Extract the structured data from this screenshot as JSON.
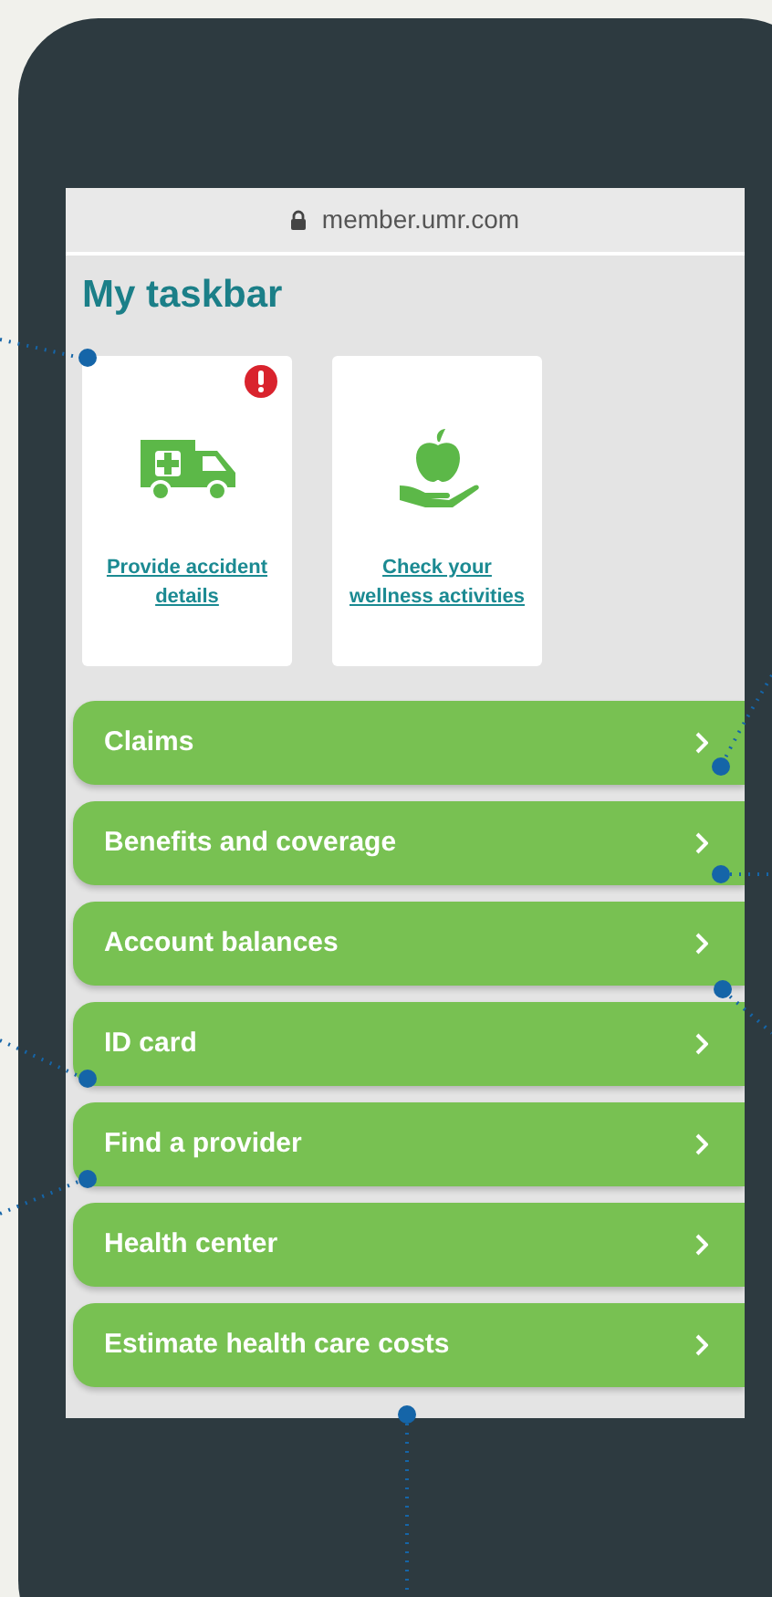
{
  "browser": {
    "url": "member.umr.com"
  },
  "title": "My taskbar",
  "tiles": [
    {
      "kind": "ambulance",
      "label": "Provide accident details",
      "alert": true
    },
    {
      "kind": "apple",
      "label": "Check your wellness activities",
      "alert": false
    }
  ],
  "menu": [
    {
      "label": "Claims"
    },
    {
      "label": "Benefits and coverage"
    },
    {
      "label": "Account balances"
    },
    {
      "label": "ID card"
    },
    {
      "label": "Find a provider"
    },
    {
      "label": "Health center"
    },
    {
      "label": "Estimate health care costs"
    }
  ]
}
